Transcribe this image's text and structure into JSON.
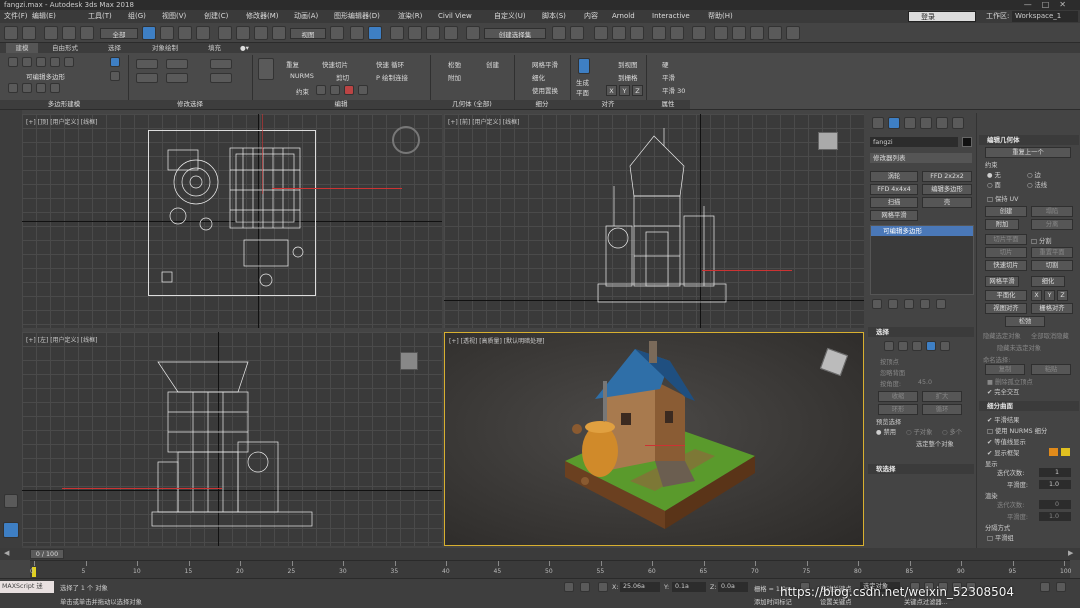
{
  "title_bar": {
    "text": "fangzi.max - Autodesk 3ds Max 2018",
    "controls": "—□✕"
  },
  "menu": {
    "items": [
      "文件(F)",
      "编辑(E)",
      "工具(T)",
      "组(G)",
      "视图(V)",
      "创建(C)",
      "修改器(M)",
      "动画(A)",
      "图形编辑器(D)",
      "渲染(R)",
      "Civil View",
      "自定义(U)",
      "脚本(S)",
      "内容",
      "Arnold",
      "Interactive",
      "帮助(H)"
    ],
    "user": "登录",
    "workspace_label": "工作区:",
    "workspace_value": "Workspace_1"
  },
  "toolbar": {
    "filter_value": "全部",
    "view_value": "视图",
    "selection_set": "创建选择集",
    "snap_value": "3"
  },
  "ribbon_tabs": [
    "建模",
    "自由形式",
    "选择",
    "对象绘制",
    "填充"
  ],
  "ribbon": {
    "poly_label": "可编辑多边形",
    "groups": [
      "多边形建模",
      "修改选择",
      "编辑",
      "几何体 (全部)",
      "细分",
      "对齐",
      "属性"
    ],
    "edit_items": [
      "重复",
      "快速切片",
      "快速 循环",
      "NURMS",
      "剪切",
      "P 绘制连接",
      "约束"
    ],
    "geom_items": [
      "松弛",
      "创建",
      "附加"
    ],
    "subdiv_items": [
      "网格平滑",
      "细化",
      "使用置换"
    ],
    "align_items": [
      "生成",
      "平面",
      "到视图",
      "到栅格",
      "X",
      "Y",
      "Z"
    ],
    "prop_items": [
      "硬",
      "平滑",
      "平滑 30"
    ]
  },
  "viewports": {
    "top": "[+] [顶] [用户定义] [线框]",
    "front": "[+] [前] [用户定义] [线框]",
    "left": "[+] [左] [用户定义] [线框]",
    "persp": "[+] [透视] [高质量] [默认明暗处理]"
  },
  "command_panel": {
    "object_name": "fangzi",
    "modifier_list": "修改器列表",
    "buttons": [
      "涡轮",
      "FFD 2x2x2",
      "FFD 4x4x4",
      "编辑多边形",
      "扫描",
      "壳",
      "网格平滑"
    ],
    "stack_item": "可编辑多边形",
    "selection_head": "选择",
    "selection_items": [
      "按顶点",
      "忽略背面",
      "按角度:",
      "45.0",
      "收缩",
      "扩大",
      "环形",
      "循环"
    ],
    "preview_label": "预览选择",
    "preview_options": [
      "禁用",
      "子对象",
      "多个"
    ],
    "select_whole": "选定整个对象",
    "soft_select": "软选择"
  },
  "modify_panel": {
    "edit_geom_head": "编辑几何体",
    "repeat_last": "重复上一个",
    "constraint_label": "约束",
    "constraint_options": [
      "无",
      "边",
      "面",
      "法线"
    ],
    "keep_uv": "保持 UV",
    "create": "创建",
    "collapse": "塌陷",
    "attach": "附加",
    "detach": "分离",
    "slice_plane": "切片平面",
    "split": "分割",
    "slice": "切片",
    "reset_plane": "重置平面",
    "quickslice": "快速切片",
    "cut": "切割",
    "meshsmooth": "网格平滑",
    "tessellate": "细化",
    "planarize": "平面化",
    "xyz": [
      "X",
      "Y",
      "Z"
    ],
    "view_align": "视图对齐",
    "grid_align": "栅格对齐",
    "relax": "松弛",
    "hide_sel": "隐藏选定对象",
    "unhide_all": "全部取消隐藏",
    "hide_unsel": "隐藏未选定对象",
    "named_sel": "命名选择:",
    "copy": "复制",
    "paste": "粘贴",
    "delete_iso": "删除孤立顶点",
    "full_interact": "完全交互",
    "subdiv_head": "细分曲面",
    "smooth_result": "平滑结果",
    "use_nurms": "使用 NURMS 细分",
    "iso_display": "等值线显示",
    "show_cage": "显示框架",
    "display_label": "显示",
    "iterations": "迭代次数:",
    "iter_val": "1",
    "smoothness": "平滑度:",
    "smooth_val": "1.0",
    "render_label": "渲染",
    "iter_val2": "0",
    "smooth_val2": "1.0",
    "sep_label": "分隔方式",
    "smooth_group": "平滑组"
  },
  "timeline": {
    "frame": "0 / 100",
    "ticks": [
      "0",
      "5",
      "10",
      "15",
      "20",
      "25",
      "30",
      "35",
      "40",
      "45",
      "50",
      "55",
      "60",
      "65",
      "70",
      "75",
      "80",
      "85",
      "90",
      "95",
      "100"
    ]
  },
  "status": {
    "maxscript": "MAXScript 迷",
    "selected": "选择了 1 个 对象",
    "hint": "单击或单击并拖动以选择对象",
    "x_label": "X:",
    "x_val": "25.06a",
    "y_label": "Y:",
    "y_val": "0.1a",
    "z_label": "Z:",
    "z_val": "0.0a",
    "grid": "栅格 = 1.0m",
    "add_time": "添加时间标记",
    "autokey": "自动关键点",
    "selobj": "选定对象",
    "setkey": "设置关键点",
    "keyfilter": "关键点过滤器...",
    "watermark": "https://blog.csdn.net/weixin_52308504"
  }
}
